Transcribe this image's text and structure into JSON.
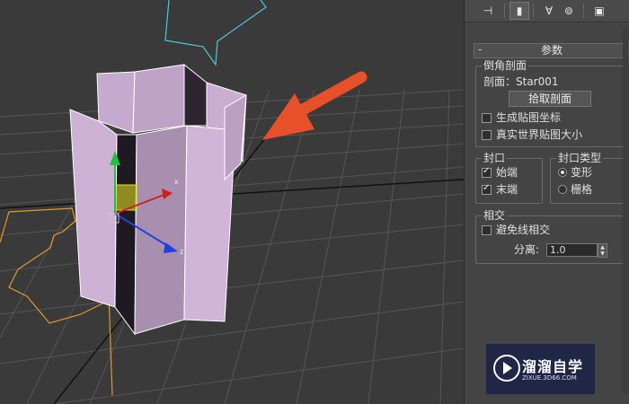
{
  "toolbar": {
    "icons": [
      "pin-stack-icon",
      "modify-icon",
      "hierarchy-icon",
      "motion-icon",
      "display-icon"
    ],
    "selected": "modify-icon"
  },
  "rollout": {
    "title": "参数",
    "collapse_symbol": "-"
  },
  "bevel_profile": {
    "title": "倒角剖面",
    "profile_label": "剖面：",
    "profile_value": "Star001",
    "pick_button": "拾取剖面",
    "gen_mapping_label": "生成贴图坐标",
    "gen_mapping_checked": false,
    "real_world_label": "真实世界贴图大小",
    "real_world_checked": false
  },
  "capping": {
    "title": "封口",
    "start_label": "始端",
    "start_checked": true,
    "end_label": "末端",
    "end_checked": true
  },
  "cap_type": {
    "title": "封口类型",
    "morph_label": "变形",
    "grid_label": "栅格",
    "selected": "morph"
  },
  "intersections": {
    "title": "相交",
    "avoid_label": "避免线相交",
    "avoid_checked": false,
    "separation_label": "分离:",
    "separation_value": "1.0"
  },
  "watermark": {
    "title": "溜溜自学",
    "url": "ZIXUE.3D66.COM"
  },
  "colors": {
    "viewport_bg": "#3a3a3a",
    "object_fill": "#c9aed1",
    "arrow": "#e8502a",
    "star_spline": "#4fc8d8",
    "path_spline": "#e09a2a"
  }
}
